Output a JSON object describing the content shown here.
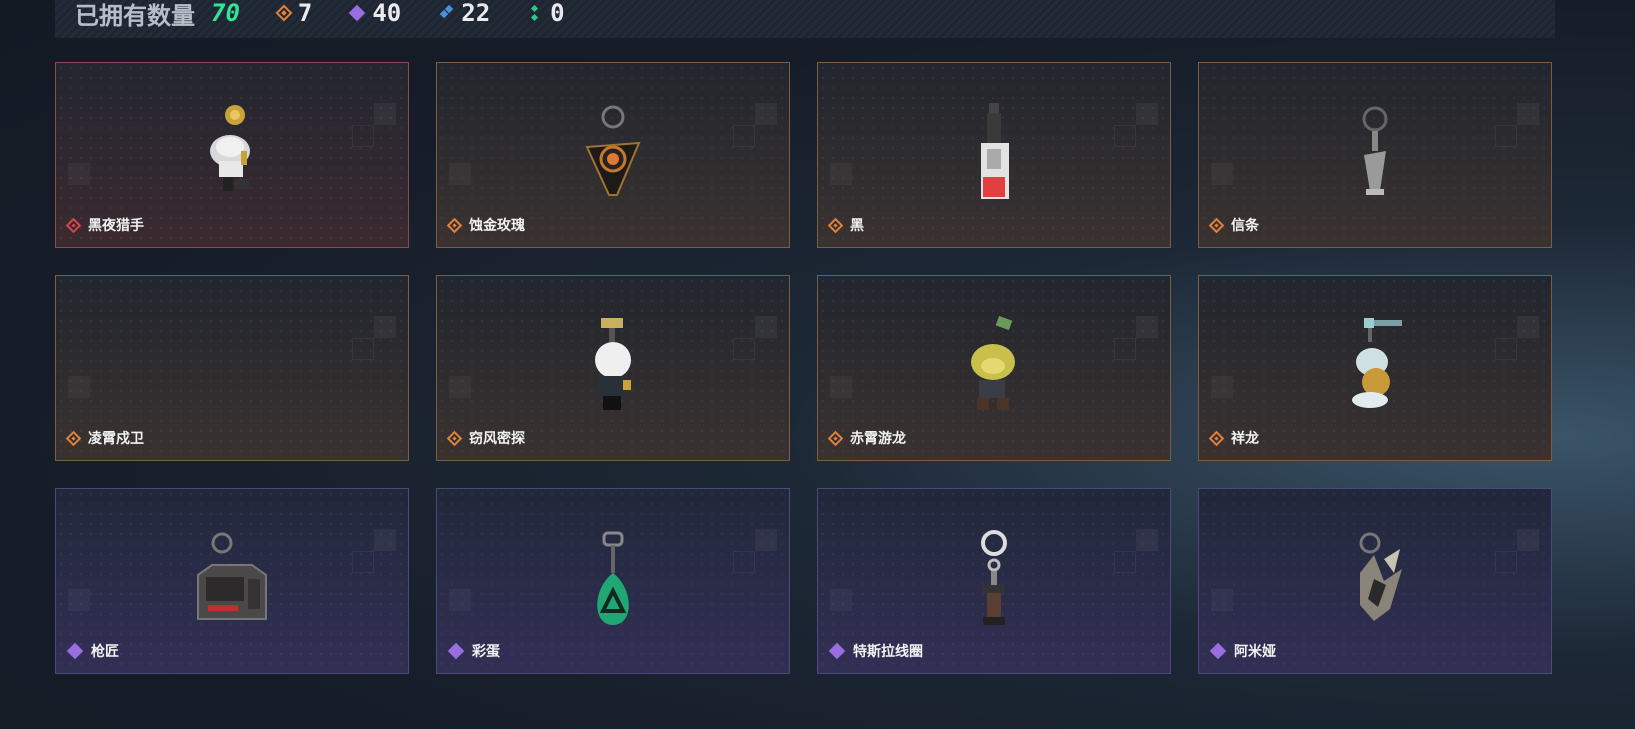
{
  "header": {
    "owned_label": "已拥有数量",
    "owned_total": "70",
    "stats": [
      {
        "icon": "orange-rarity-icon",
        "color": "#e0823c",
        "count": "7"
      },
      {
        "icon": "purple-rarity-icon",
        "color": "#9a6ee0",
        "count": "40"
      },
      {
        "icon": "blue-rarity-icon",
        "color": "#4a90d8",
        "count": "22"
      },
      {
        "icon": "green-rarity-icon",
        "color": "#2ec98a",
        "count": "0"
      }
    ]
  },
  "items": [
    {
      "name": "黑夜猎手",
      "rarity": "red",
      "color": "#d8454e",
      "icon": "night-hunter-charm-icon"
    },
    {
      "name": "蚀金玫瑰",
      "rarity": "orange",
      "color": "#e0823c",
      "icon": "gold-rose-charm-icon"
    },
    {
      "name": "黑",
      "rarity": "orange",
      "color": "#e0823c",
      "icon": "black-charm-icon"
    },
    {
      "name": "信条",
      "rarity": "orange",
      "color": "#e0823c",
      "icon": "creed-charm-icon"
    },
    {
      "name": "凌霄戍卫",
      "rarity": "orange",
      "color": "#e0823c",
      "icon": "sky-guard-charm-icon"
    },
    {
      "name": "窃风密探",
      "rarity": "orange",
      "color": "#e0823c",
      "icon": "wind-spy-charm-icon"
    },
    {
      "name": "赤霄游龙",
      "rarity": "orange",
      "color": "#e0823c",
      "icon": "crimson-dragon-charm-icon"
    },
    {
      "name": "祥龙",
      "rarity": "orange",
      "color": "#e0823c",
      "icon": "lucky-dragon-charm-icon"
    },
    {
      "name": "枪匠",
      "rarity": "purple",
      "color": "#9a6ee0",
      "icon": "gunsmith-charm-icon"
    },
    {
      "name": "彩蛋",
      "rarity": "purple",
      "color": "#9a6ee0",
      "icon": "easter-egg-charm-icon"
    },
    {
      "name": "特斯拉线圈",
      "rarity": "purple",
      "color": "#9a6ee0",
      "icon": "tesla-coil-charm-icon"
    },
    {
      "name": "阿米娅",
      "rarity": "purple",
      "color": "#9a6ee0",
      "icon": "amiya-charm-icon"
    }
  ]
}
